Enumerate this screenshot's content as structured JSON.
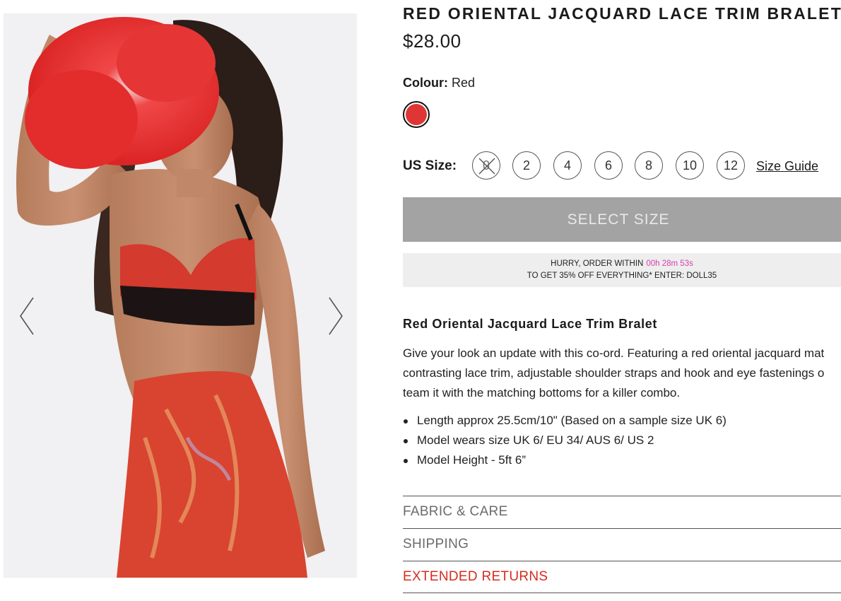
{
  "gallery": {
    "prev_icon": "chevron-left-icon",
    "next_icon": "chevron-right-icon"
  },
  "product": {
    "title": "RED ORIENTAL JACQUARD LACE TRIM BRALET",
    "price": "$28.00"
  },
  "colour": {
    "label": "Colour:",
    "value": "Red",
    "swatch_color": "#e03535"
  },
  "sizes": {
    "label": "US Size:",
    "options": [
      {
        "label": "0",
        "available": false
      },
      {
        "label": "2",
        "available": true
      },
      {
        "label": "4",
        "available": true
      },
      {
        "label": "6",
        "available": true
      },
      {
        "label": "8",
        "available": true
      },
      {
        "label": "10",
        "available": true
      },
      {
        "label": "12",
        "available": true
      }
    ],
    "guide_label": "Size Guide"
  },
  "cta": {
    "select_size_label": "SELECT SIZE"
  },
  "promo": {
    "line1_prefix": "HURRY, ORDER WITHIN",
    "timer": "00h 28m 53s",
    "line2": "TO GET 35% OFF EVERYTHING* ENTER: DOLL35"
  },
  "description": {
    "heading": "Red Oriental Jacquard Lace Trim Bralet",
    "lines": [
      "Give your look an update with this co-ord. Featuring a red oriental jacquard mat",
      "contrasting lace trim, adjustable shoulder straps and hook and eye fastenings o",
      "team it with the matching bottoms for a killer combo."
    ],
    "bullets": [
      "Length approx 25.5cm/10\" (Based on a sample size UK 6)",
      "Model wears size UK 6/ EU 34/ AUS 6/ US 2",
      "Model Height - 5ft 6”"
    ]
  },
  "accordion": {
    "fabric_care": "FABRIC & CARE",
    "shipping": "SHIPPING",
    "extended_returns": "EXTENDED RETURNS"
  },
  "colors": {
    "accent_red": "#d62b1f",
    "timer_pink": "#d63fae",
    "button_gray": "#a3a3a3"
  }
}
